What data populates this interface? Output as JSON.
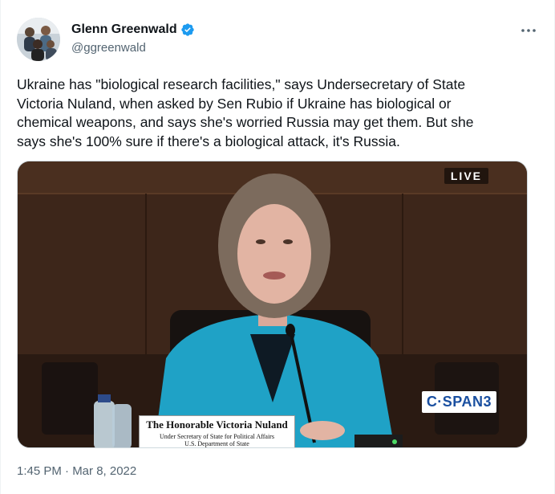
{
  "author": {
    "name": "Glenn Greenwald",
    "handle": "@ggreenwald",
    "verified_icon": "verified-badge-icon"
  },
  "more_icon": "more-dots-icon",
  "tweet": {
    "text": "Ukraine has \"biological research facilities,\" says Undersecretary of State\nVictoria Nuland, when asked by Sen Rubio if Ukraine has biological or\nchemical weapons, and says she's worried Russia may get them. But she\nsays she's 100% sure if there's a biological attack, it's Russia."
  },
  "media": {
    "live_label": "LIVE",
    "network_logo": "C·SPAN",
    "network_channel": "3",
    "nameplate_name": "The Honorable Victoria Nuland",
    "nameplate_title": "Under Secretary of State for Political Affairs",
    "nameplate_dept": "U.S. Department of State"
  },
  "timestamp": "1:45 PM · Mar 8, 2022",
  "colors": {
    "text": "#0f1419",
    "secondary": "#536471",
    "verified": "#1d9bf0",
    "cspan_blue": "#1a4fa0"
  }
}
